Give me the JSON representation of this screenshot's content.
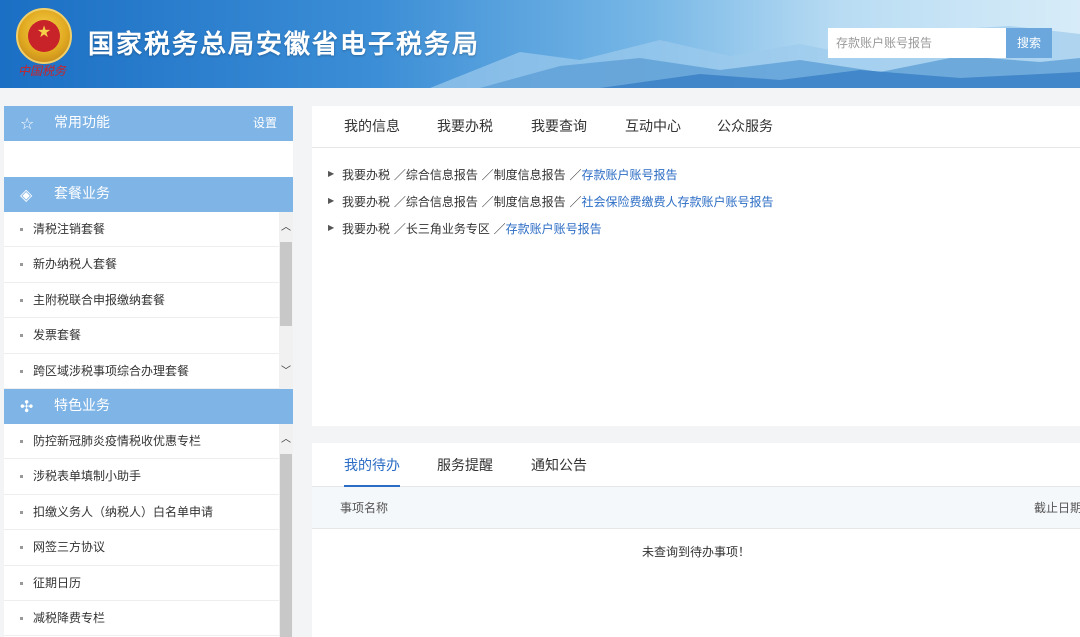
{
  "header": {
    "title": "国家税务总局安徽省电子税务局",
    "emblem_caption": "中国税务",
    "search_placeholder": "存款账户账号报告",
    "search_button": "搜索"
  },
  "sidebar": {
    "common": {
      "label": "常用功能",
      "settings": "设置",
      "icon": "star-outline-icon"
    },
    "package": {
      "label": "套餐业务",
      "icon": "layers-icon",
      "items": [
        "清税注销套餐",
        "新办纳税人套餐",
        "主附税联合申报缴纳套餐",
        "发票套餐",
        "跨区域涉税事项综合办理套餐"
      ]
    },
    "special": {
      "label": "特色业务",
      "icon": "grid-flower-icon",
      "items": [
        "防控新冠肺炎疫情税收优惠专栏",
        "涉税表单填制小助手",
        "扣缴义务人（纳税人）白名单申请",
        "网签三方协议",
        "征期日历",
        "减税降费专栏"
      ]
    }
  },
  "main": {
    "tabs": [
      "我的信息",
      "我要办税",
      "我要查询",
      "互动中心",
      "公众服务"
    ],
    "results": [
      {
        "path": "我要办税 ／综合信息报告 ／制度信息报告 ／",
        "link": "存款账户账号报告"
      },
      {
        "path": "我要办税 ／综合信息报告 ／制度信息报告 ／",
        "link": "社会保险费缴费人存款账户账号报告"
      },
      {
        "path": "我要办税 ／长三角业务专区 ／",
        "link": "存款账户账号报告"
      }
    ]
  },
  "todo": {
    "tabs": [
      "我的待办",
      "服务提醒",
      "通知公告"
    ],
    "active_tab": "我的待办",
    "col_name": "事项名称",
    "col_deadline": "截止日期",
    "empty_text": "未查询到待办事项！"
  },
  "colors": {
    "header_blue": "#1b6fc4",
    "sidebar_head": "#7fb4e6",
    "link": "#2b6cc4"
  }
}
